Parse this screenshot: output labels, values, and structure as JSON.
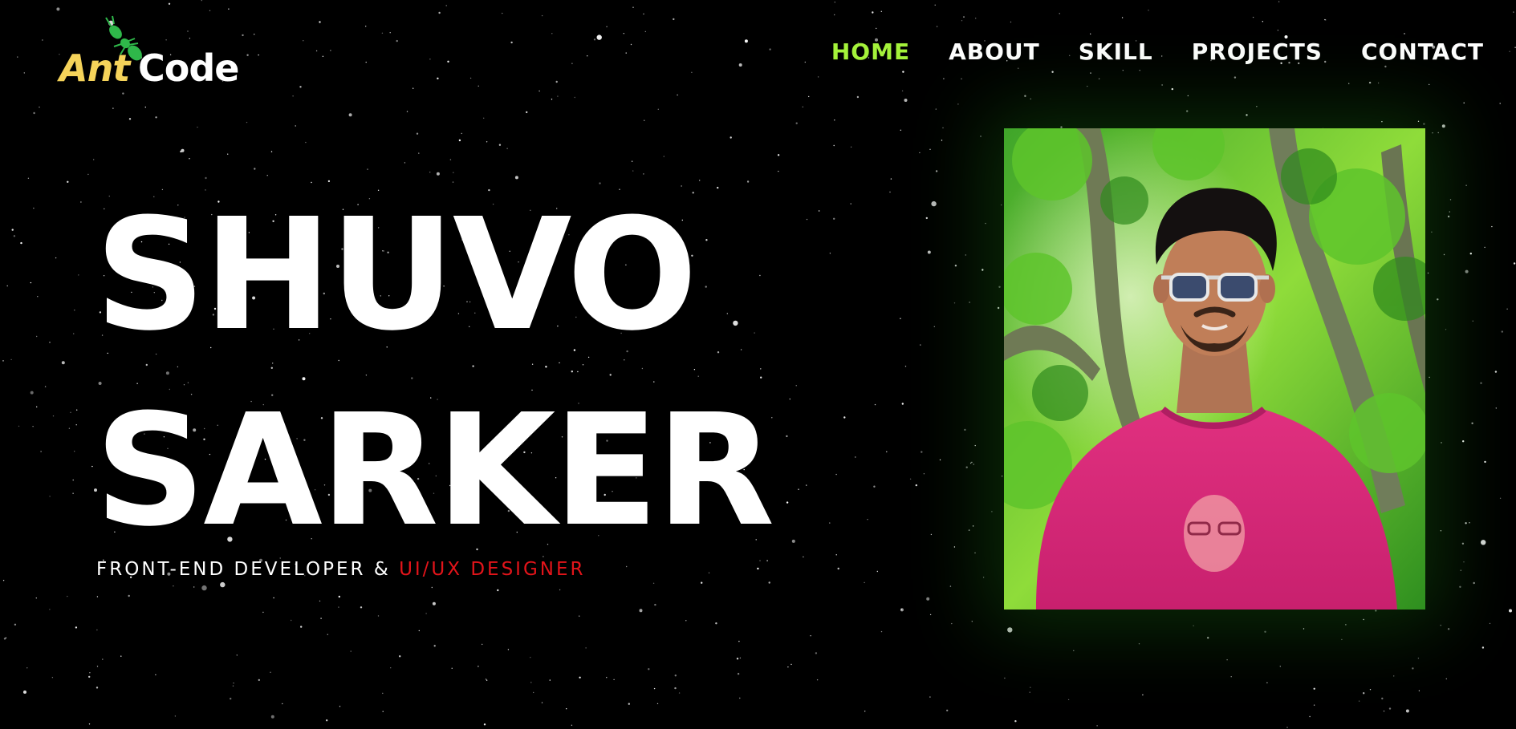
{
  "logo": {
    "part1": "Ant",
    "part2": "Code",
    "icon": "ant-icon",
    "colors": {
      "ant": "#f5d35a",
      "code": "#ffffff",
      "icon": "#2fb84a"
    }
  },
  "nav": {
    "items": [
      {
        "label": "HOME",
        "active": true
      },
      {
        "label": "ABOUT",
        "active": false
      },
      {
        "label": "SKILL",
        "active": false
      },
      {
        "label": "PROJECTS",
        "active": false
      },
      {
        "label": "CONTACT",
        "active": false
      }
    ],
    "active_color": "#a4f23a"
  },
  "hero": {
    "first_name": "SHUVO",
    "last_name": "SARKER",
    "subtitle_prefix": "FRONT-END DEVELOPER & ",
    "subtitle_accent": "UI/UX DESIGNER",
    "accent_color": "#e3141a"
  },
  "profile_photo": {
    "subject": "portrait-photo",
    "colors": {
      "shirt": "#d62a7a",
      "foliage": "#4fbf2a",
      "glow": "#1e7814"
    }
  },
  "background": {
    "color": "#000000",
    "pattern": "starfield"
  }
}
